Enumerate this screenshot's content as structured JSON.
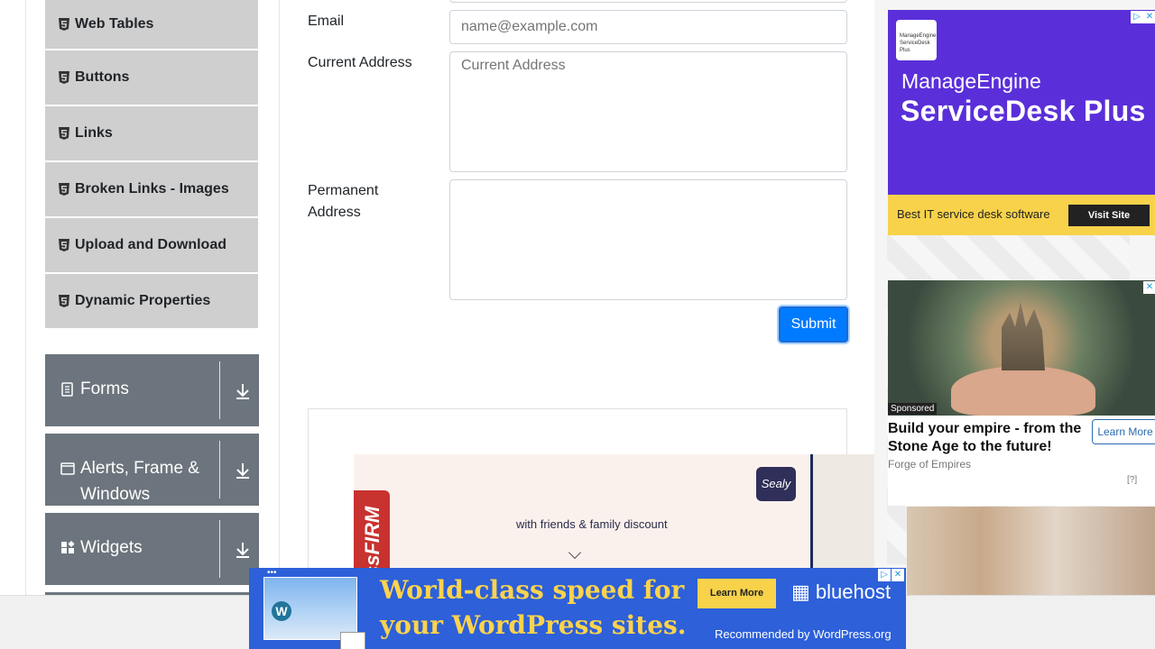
{
  "sidebar": {
    "items": [
      {
        "label": "Web Tables",
        "icon": "html5-icon"
      },
      {
        "label": "Buttons",
        "icon": "html5-icon"
      },
      {
        "label": "Links",
        "icon": "html5-icon"
      },
      {
        "label": "Broken Links - Images",
        "icon": "html5-icon"
      },
      {
        "label": "Upload and Download",
        "icon": "html5-icon"
      },
      {
        "label": "Dynamic Properties",
        "icon": "html5-icon"
      }
    ],
    "groups": [
      {
        "label": "Forms",
        "icon": "document-icon"
      },
      {
        "label": "Alerts, Frame & Windows",
        "icon": "window-icon"
      },
      {
        "label": "Widgets",
        "icon": "widgets-icon"
      }
    ]
  },
  "form": {
    "email_label": "Email",
    "email_placeholder": "name@example.com",
    "current_label": "Current Address",
    "current_placeholder": "Current Address",
    "permanent_label": "Permanent Address",
    "permanent_placeholder": "",
    "submit_label": "Submit",
    "accent": "#007bff"
  },
  "ads": {
    "sealy": {
      "tab_text": "ssFIRM",
      "tagline": "with friends & family discount",
      "badge": "Sealy"
    },
    "manageengine": {
      "logo_text": "ManageEngine ServiceDesk Plus",
      "brand": "ManageEngine",
      "product": "ServiceDesk Plus",
      "tagline": "Best IT service desk software",
      "cta": "Visit Site"
    },
    "castle": {
      "sponsored": "Sponsored",
      "headline": "Build your empire - from the Stone Age to the future!",
      "advertiser": "Forge of Empires",
      "cta": "Learn More",
      "help": "[?]"
    },
    "bluehost": {
      "line1": "World-class speed for",
      "line2": "your WordPress sites.",
      "cta": "Learn More",
      "brand": "bluehost",
      "recommended": "Recommended by WordPress.org"
    }
  }
}
